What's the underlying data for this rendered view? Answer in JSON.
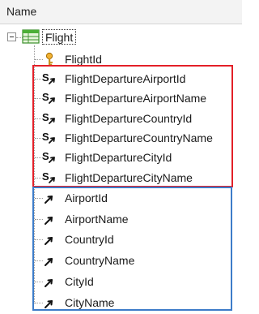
{
  "header": {
    "title": "Name"
  },
  "root": {
    "label": "Flight",
    "icon": "table-transaction-icon"
  },
  "key_attribute": {
    "label": "FlightId",
    "icon": "key-icon"
  },
  "subtype_attributes": {
    "icon": "subtype-attribute-icon",
    "labels": [
      "FlightDepartureAirportId",
      "FlightDepartureAirportName",
      "FlightDepartureCountryId",
      "FlightDepartureCountryName",
      "FlightDepartureCityId",
      "FlightDepartureCityName"
    ]
  },
  "inferred_attributes": {
    "icon": "inferred-attribute-icon",
    "labels": [
      "AirportId",
      "AirportName",
      "CountryId",
      "CountryName",
      "CityId",
      "CityName"
    ]
  },
  "colors": {
    "highlight_red": "#e32028",
    "highlight_blue": "#3d7cc9"
  }
}
